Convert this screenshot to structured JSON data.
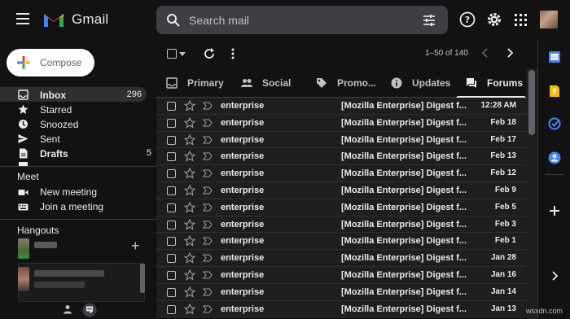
{
  "header": {
    "brand": "Gmail",
    "search_placeholder": "Search mail",
    "icons": [
      "menu-icon",
      "gmail-logo",
      "search-icon",
      "tune-icon",
      "help-icon",
      "settings-icon",
      "apps-icon",
      "avatar"
    ]
  },
  "compose": {
    "label": "Compose"
  },
  "nav": [
    {
      "label": "Inbox",
      "count": "296",
      "icon": "inbox-icon"
    },
    {
      "label": "Starred",
      "count": "",
      "icon": "star-icon"
    },
    {
      "label": "Snoozed",
      "count": "",
      "icon": "clock-icon"
    },
    {
      "label": "Sent",
      "count": "",
      "icon": "send-icon"
    },
    {
      "label": "Drafts",
      "count": "5",
      "icon": "draft-icon"
    }
  ],
  "meet": {
    "title": "Meet",
    "items": [
      {
        "label": "New meeting",
        "icon": "video-icon"
      },
      {
        "label": "Join a meeting",
        "icon": "keyboard-icon"
      }
    ]
  },
  "hangouts": {
    "title": "Hangouts"
  },
  "toolbar": {
    "pager": "1–50 of 140"
  },
  "tabs": [
    {
      "label": "Primary",
      "icon": "inbox-icon"
    },
    {
      "label": "Social",
      "icon": "people-icon"
    },
    {
      "label": "Promo...",
      "icon": "tag-icon"
    },
    {
      "label": "Updates",
      "icon": "info-icon"
    },
    {
      "label": "Forums",
      "icon": "forum-icon"
    }
  ],
  "emails": [
    {
      "sender": "enterprise",
      "subject": "[Mozilla Enterprise] Digest f...",
      "date": "12:28 AM"
    },
    {
      "sender": "enterprise",
      "subject": "[Mozilla Enterprise] Digest f...",
      "date": "Feb 18"
    },
    {
      "sender": "enterprise",
      "subject": "[Mozilla Enterprise] Digest f...",
      "date": "Feb 17"
    },
    {
      "sender": "enterprise",
      "subject": "[Mozilla Enterprise] Digest f...",
      "date": "Feb 13"
    },
    {
      "sender": "enterprise",
      "subject": "[Mozilla Enterprise] Digest f...",
      "date": "Feb 12"
    },
    {
      "sender": "enterprise",
      "subject": "[Mozilla Enterprise] Digest f...",
      "date": "Feb 9"
    },
    {
      "sender": "enterprise",
      "subject": "[Mozilla Enterprise] Digest f...",
      "date": "Feb 5"
    },
    {
      "sender": "enterprise",
      "subject": "[Mozilla Enterprise] Digest f...",
      "date": "Feb 3"
    },
    {
      "sender": "enterprise",
      "subject": "[Mozilla Enterprise] Digest f...",
      "date": "Feb 1"
    },
    {
      "sender": "enterprise",
      "subject": "[Mozilla Enterprise] Digest f...",
      "date": "Jan 28"
    },
    {
      "sender": "enterprise",
      "subject": "[Mozilla Enterprise] Digest f...",
      "date": "Jan 16"
    },
    {
      "sender": "enterprise",
      "subject": "[Mozilla Enterprise] Digest f...",
      "date": "Jan 14"
    },
    {
      "sender": "enterprise",
      "subject": "[Mozilla Enterprise] Digest f...",
      "date": "Jan 13"
    }
  ],
  "watermark": "wsxdn.com",
  "colors": {
    "background": "#121212",
    "row": "#1e1e1e",
    "search": "#3c4043",
    "accent_blue": "#4285f4",
    "accent_red": "#ea4335",
    "accent_yellow": "#fbbc04",
    "accent_green": "#34a853"
  }
}
